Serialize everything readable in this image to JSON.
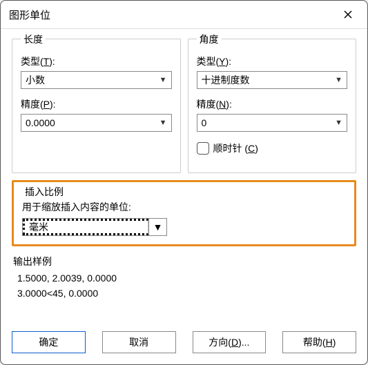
{
  "window": {
    "title": "图形单位"
  },
  "length": {
    "group_title": "长度",
    "type_label_pre": "类型(",
    "type_hotkey": "T",
    "type_label_post": "):",
    "type_value": "小数",
    "precision_label_pre": "精度(",
    "precision_hotkey": "P",
    "precision_label_post": "):",
    "precision_value": "0.0000"
  },
  "angle": {
    "group_title": "角度",
    "type_label_pre": "类型(",
    "type_hotkey": "Y",
    "type_label_post": "):",
    "type_value": "十进制度数",
    "precision_label_pre": "精度(",
    "precision_hotkey": "N",
    "precision_label_post": "):",
    "precision_value": "0",
    "clockwise_label_pre": "顺时针 (",
    "clockwise_hotkey": "C",
    "clockwise_label_post": ")",
    "clockwise_checked": false
  },
  "insert": {
    "group_title": "插入比例",
    "desc": "用于缩放插入内容的单位:",
    "value": "毫米"
  },
  "sample": {
    "group_title": "输出样例",
    "line1": "1.5000, 2.0039, 0.0000",
    "line2": "3.0000<45, 0.0000"
  },
  "buttons": {
    "ok": "确定",
    "cancel": "取消",
    "direction_pre": "方向(",
    "direction_hotkey": "D",
    "direction_post": ")...",
    "help_pre": "帮助(",
    "help_hotkey": "H",
    "help_post": ")"
  }
}
